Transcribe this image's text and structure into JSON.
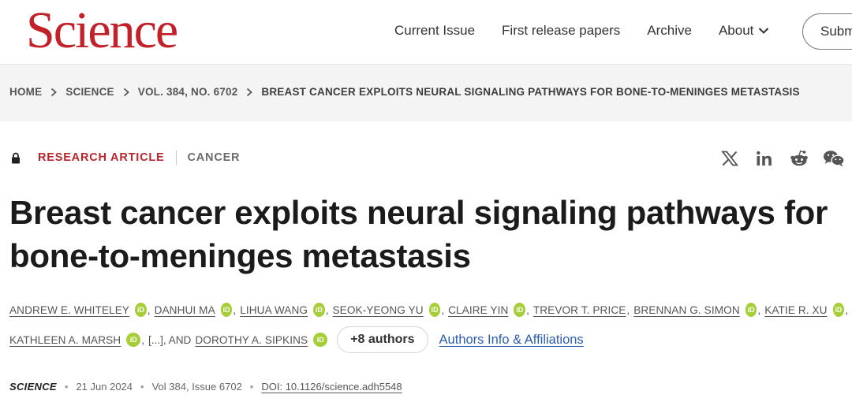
{
  "header": {
    "logo": "Science",
    "nav": [
      "Current Issue",
      "First release papers",
      "Archive",
      "About"
    ],
    "submit_label": "Submit manuscript"
  },
  "breadcrumb": [
    "HOME",
    "SCIENCE",
    "VOL. 384, NO. 6702",
    "BREAST CANCER EXPLOITS NEURAL SIGNALING PATHWAYS FOR BONE-TO-MENINGES METASTASIS"
  ],
  "article": {
    "type": "RESEARCH ARTICLE",
    "category": "CANCER",
    "title": "Breast cancer exploits neural signaling pathways for bone-to-meninges metastasis"
  },
  "share_icons": [
    "x-icon",
    "linkedin-icon",
    "reddit-icon",
    "wechat-icon"
  ],
  "authors": {
    "line1": [
      "ANDREW E. WHITELEY",
      "DANHUI MA",
      "LIHUA WANG",
      "SEOK-YEONG YU",
      "CLAIRE YIN",
      "TREVOR T. PRICE",
      "BRENNAN G. SIMON",
      "KATIE R. XU"
    ],
    "line2_first": "KATHLEEN A. MARSH",
    "ellipsis": "[...], AND",
    "last": "DOROTHY A. SIPKINS",
    "orcid_label": "iD",
    "more_label": "+8 authors",
    "affiliations_label": "Authors Info & Affiliations"
  },
  "citation": {
    "journal": "SCIENCE",
    "date": "21 Jun 2024",
    "volume": "Vol 384, Issue 6702",
    "doi": "DOI: 10.1126/science.adh5548"
  },
  "colors": {
    "brand": "#c2212a",
    "orcid": "#a6ce39",
    "link": "#2a5db0"
  }
}
